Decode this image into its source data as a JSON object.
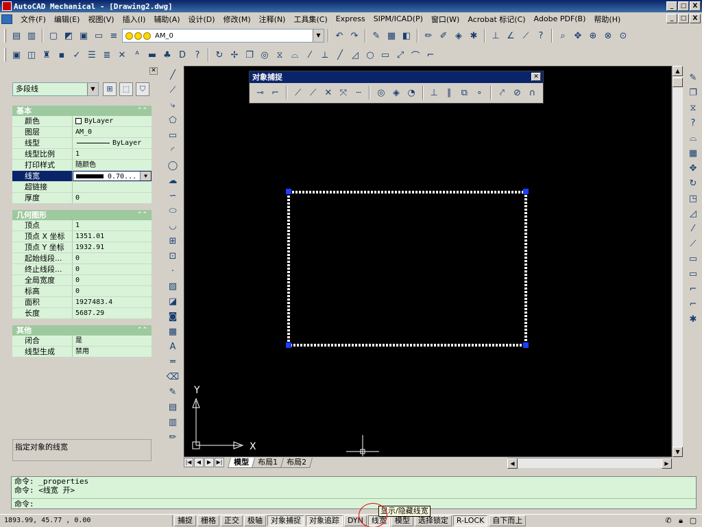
{
  "app": {
    "title": "AutoCAD Mechanical - [Drawing2.dwg]",
    "window_buttons": [
      "_",
      "□",
      "X"
    ]
  },
  "menu": {
    "items": [
      "文件(F)",
      "编辑(E)",
      "视图(V)",
      "插入(I)",
      "辅助(A)",
      "设计(D)",
      "修改(M)",
      "注释(N)",
      "工具集(C)",
      "Express",
      "SIPM/ICAD(P)",
      "窗口(W)",
      "Acrobat 标记(C)",
      "Adobe PDF(B)",
      "帮助(H)"
    ]
  },
  "toolbar": {
    "layer_name": "AM_0"
  },
  "properties": {
    "object_type": "多段线",
    "sections": [
      {
        "title": "基本",
        "rows": [
          {
            "key": "颜色",
            "value": "ByLayer"
          },
          {
            "key": "图层",
            "value": "AM_0"
          },
          {
            "key": "线型",
            "value": "ByLayer"
          },
          {
            "key": "线型比例",
            "value": "1"
          },
          {
            "key": "打印样式",
            "value": "随颜色"
          },
          {
            "key": "线宽",
            "value": "0.70..."
          },
          {
            "key": "超链接",
            "value": ""
          },
          {
            "key": "厚度",
            "value": "0"
          }
        ]
      },
      {
        "title": "几何图形",
        "rows": [
          {
            "key": "顶点",
            "value": "1"
          },
          {
            "key": "顶点 X 坐标",
            "value": "1351.01"
          },
          {
            "key": "顶点 Y 坐标",
            "value": "1932.91"
          },
          {
            "key": "起始线段...",
            "value": "0"
          },
          {
            "key": "终止线段...",
            "value": "0"
          },
          {
            "key": "全局宽度",
            "value": "0"
          },
          {
            "key": "标高",
            "value": "0"
          },
          {
            "key": "面积",
            "value": "1927483.4"
          },
          {
            "key": "长度",
            "value": "5687.29"
          }
        ]
      },
      {
        "title": "其他",
        "rows": [
          {
            "key": "闭合",
            "value": "是"
          },
          {
            "key": "线型生成",
            "value": "禁用"
          }
        ]
      }
    ],
    "description": "指定对象的线宽"
  },
  "osnap": {
    "title": "对象捕捉"
  },
  "canvas": {
    "ucs_x": "X",
    "ucs_y": "Y"
  },
  "tabs": [
    "模型",
    "布局1",
    "布局2"
  ],
  "command": {
    "history": [
      "命令: _properties",
      "命令: <线宽 开>"
    ],
    "prompt": "命令:"
  },
  "status": {
    "coords": "1893.99, 45.77 , 0.00",
    "buttons": [
      {
        "label": "捕捉",
        "on": false
      },
      {
        "label": "栅格",
        "on": false
      },
      {
        "label": "正交",
        "on": false
      },
      {
        "label": "极轴",
        "on": false
      },
      {
        "label": "对象捕捉",
        "on": true
      },
      {
        "label": "对象追踪",
        "on": true
      },
      {
        "label": "DYN",
        "on": false
      },
      {
        "label": "线宽",
        "on": true
      },
      {
        "label": "模型",
        "on": false
      },
      {
        "label": "选择锁定",
        "on": false
      },
      {
        "label": "R-LOCK",
        "on": true
      },
      {
        "label": "自下而上",
        "on": false
      }
    ],
    "tooltip": "显示/隐藏线宽"
  }
}
